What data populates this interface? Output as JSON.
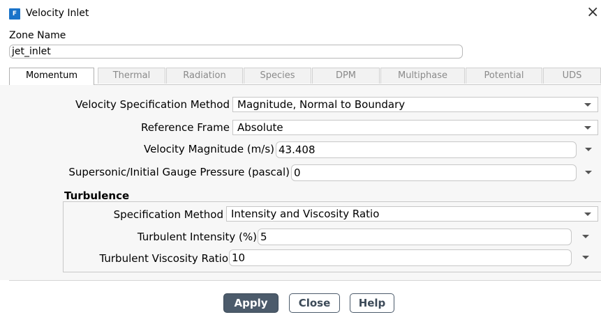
{
  "window": {
    "title": "Velocity Inlet",
    "app_icon_letter": "F",
    "close_glyph": "×"
  },
  "zone": {
    "label": "Zone Name",
    "value": "jet_inlet"
  },
  "tabs": [
    {
      "label": "Momentum",
      "active": true
    },
    {
      "label": "Thermal",
      "active": false
    },
    {
      "label": "Radiation",
      "active": false
    },
    {
      "label": "Species",
      "active": false
    },
    {
      "label": "DPM",
      "active": false
    },
    {
      "label": "Multiphase",
      "active": false
    },
    {
      "label": "Potential",
      "active": false
    },
    {
      "label": "UDS",
      "active": false
    }
  ],
  "momentum": {
    "velocity_method": {
      "label": "Velocity Specification Method",
      "value": "Magnitude, Normal to Boundary"
    },
    "reference_frame": {
      "label": "Reference Frame",
      "value": "Absolute"
    },
    "velocity_magnitude": {
      "label": "Velocity Magnitude (m/s)",
      "value": "43.408"
    },
    "gauge_pressure": {
      "label": "Supersonic/Initial Gauge Pressure (pascal)",
      "value": "0"
    }
  },
  "turbulence": {
    "title": "Turbulence",
    "spec_method": {
      "label": "Specification Method",
      "value": "Intensity and Viscosity Ratio"
    },
    "intensity": {
      "label": "Turbulent Intensity (%)",
      "value": "5"
    },
    "viscosity_ratio": {
      "label": "Turbulent Viscosity Ratio",
      "value": "10"
    }
  },
  "buttons": {
    "apply": "Apply",
    "close": "Close",
    "help": "Help"
  },
  "colors": {
    "accent": "#1a73c9",
    "apply_button": "#4c5b6b"
  }
}
